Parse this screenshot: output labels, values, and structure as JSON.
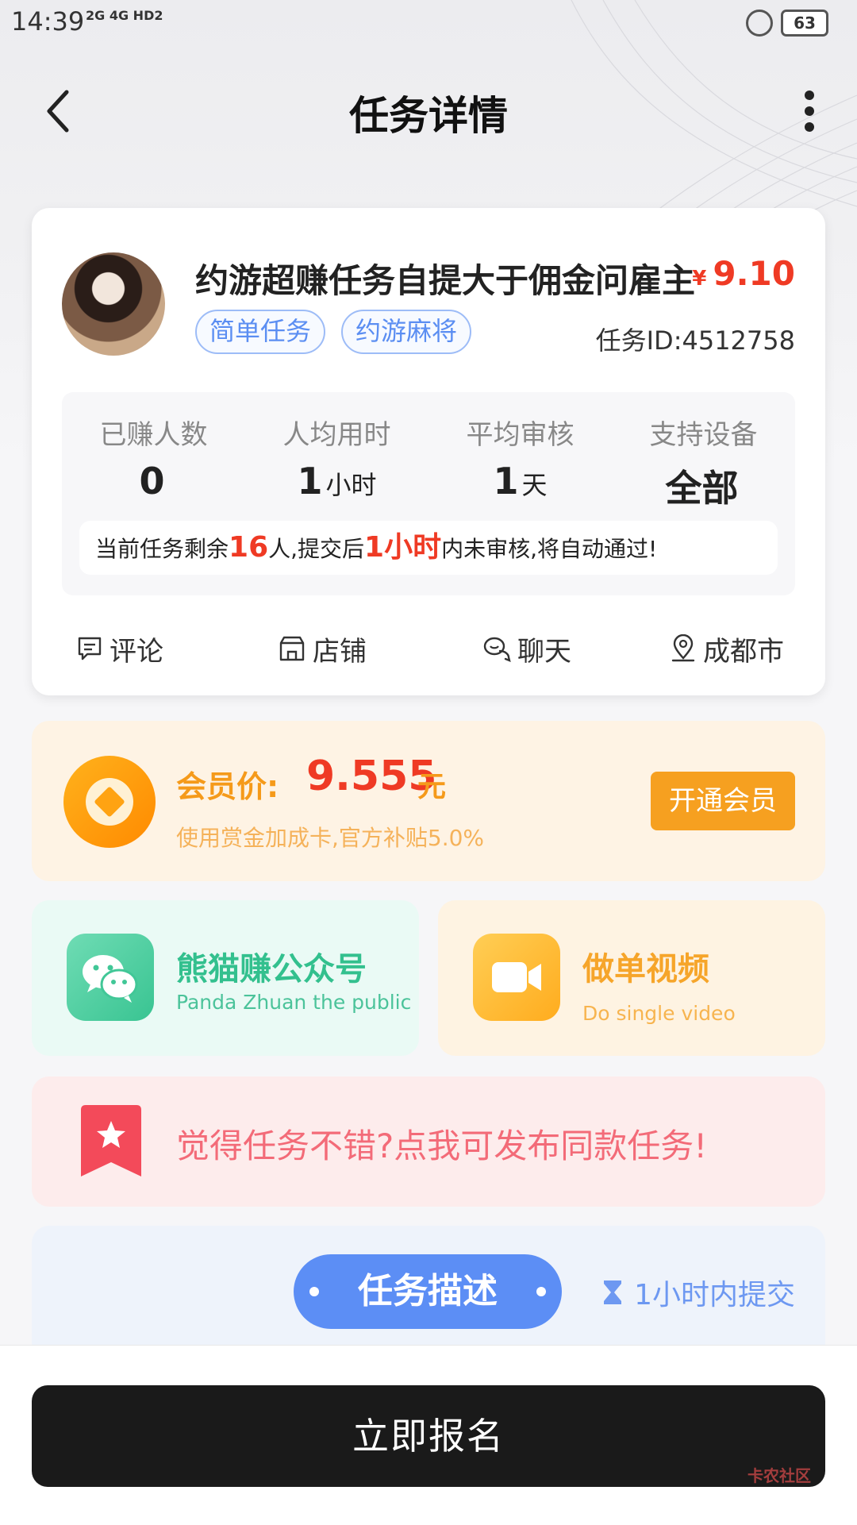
{
  "status_bar": {
    "time": "14:39",
    "signal_text": "2G 4G HD2",
    "battery": "63"
  },
  "nav": {
    "title": "任务详情"
  },
  "task": {
    "title": "约游超赚任务自提大于佣金问雇主",
    "price_currency": "¥",
    "price": "9.10",
    "tags": [
      "简单任务",
      "约游麻将"
    ],
    "task_id": "任务ID:4512758",
    "stats": [
      {
        "label": "已赚人数",
        "value": "0",
        "unit": ""
      },
      {
        "label": "人均用时",
        "value": "1",
        "unit": "小时"
      },
      {
        "label": "平均审核",
        "value": "1",
        "unit": "天"
      },
      {
        "label": "支持设备",
        "value": "全部",
        "unit": ""
      }
    ],
    "notice": {
      "p1": "当前任务剩余",
      "remaining": "16",
      "p2": "人,提交后",
      "hours": "1小时",
      "p3": "内未审核,将自动通过!"
    },
    "actions": [
      "评论",
      "店铺",
      "聊天",
      "成都市"
    ]
  },
  "member": {
    "label": "会员价:",
    "price": "9.555",
    "unit": "元",
    "subtitle": "使用赏金加成卡,官方补贴5.0%",
    "button": "开通会员"
  },
  "promos": [
    {
      "title": "熊猫赚公众号",
      "subtitle": "Panda Zhuan the public"
    },
    {
      "title": "做单视频",
      "subtitle": "Do single video"
    }
  ],
  "publish": {
    "text": "觉得任务不错?点我可发布同款任务!"
  },
  "description": {
    "title": "任务描述",
    "time_limit": "1小时内提交"
  },
  "bottom": {
    "signup_button": "立即报名",
    "watermark": "卡农社区"
  },
  "colors": {
    "price_red": "#ef3a24",
    "accent_blue": "#5c8ef5",
    "member_orange": "#f6a020",
    "green": "#33c08e"
  }
}
